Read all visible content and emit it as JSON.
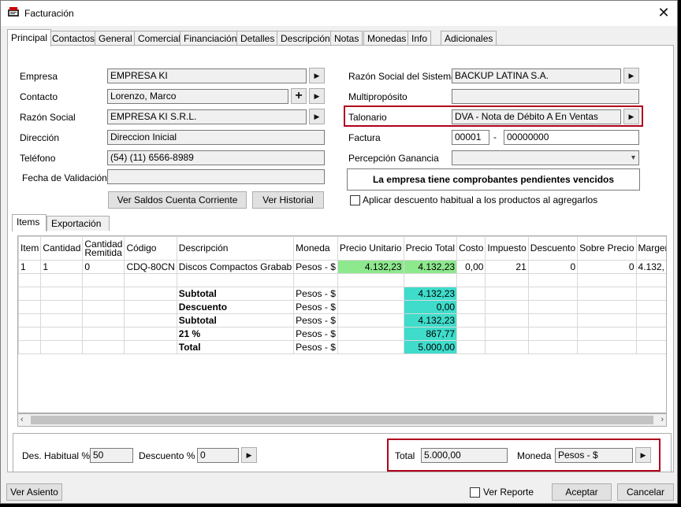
{
  "window": {
    "title": "Facturación",
    "close": "✕"
  },
  "tabs": [
    "Principal",
    "Contactos",
    "General",
    "Comercial",
    "Financiación",
    "Detalles",
    "Descripción",
    "Notas",
    "Monedas",
    "Info",
    "Adicionales"
  ],
  "left": {
    "empresa_label": "Empresa",
    "empresa_value": "EMPRESA KI",
    "contacto_label": "Contacto",
    "contacto_value": "Lorenzo, Marco",
    "razon_label": "Razón Social",
    "razon_value": "EMPRESA KI S.R.L.",
    "direccion_label": "Dirección",
    "direccion_value": "Direccion Inicial",
    "telefono_label": "Teléfono",
    "telefono_value": "(54) (11) 6566-8989",
    "fecha_label": "Fecha de Validación",
    "fecha_value": "",
    "ver_saldos": "Ver Saldos Cuenta Corriente",
    "ver_historial": "Ver Historial"
  },
  "right": {
    "razon_sistema_label": "Razón Social del Sistema",
    "razon_sistema_value": "BACKUP LATINA S.A.",
    "multiproposito_label": "Multipropósito",
    "multiproposito_value": "",
    "talonario_label": "Talonario",
    "talonario_value": "DVA - Nota de Débito A En Ventas",
    "factura_label": "Factura",
    "factura_punto": "00001",
    "factura_sep": "-",
    "factura_numero": "00000000",
    "percepcion_label": "Percepción Ganancia",
    "alert": "La empresa tiene comprobantes pendientes vencidos",
    "descuento_habitual": "Aplicar descuento habitual a los productos al agregarlos"
  },
  "subtabs": [
    "Items",
    "Exportación"
  ],
  "grid": {
    "headers": [
      "Item",
      "Cantidad",
      "Cantidad Remitida",
      "Código",
      "Descripción",
      "Moneda",
      "Precio Unitario",
      "Precio Total",
      "Costo",
      "Impuesto",
      "Descuento",
      "Sobre Precio",
      "Margen"
    ],
    "item_row": [
      "1",
      "1",
      "0",
      "CDQ-80CN",
      "Discos Compactos Grabab",
      "Pesos - $",
      "4.132,23",
      "4.132,23",
      "0,00",
      "21",
      "0",
      "0",
      "4.132,"
    ],
    "totals": [
      {
        "label": "Subtotal",
        "moneda": "Pesos - $",
        "value": "4.132,23"
      },
      {
        "label": "Descuento",
        "moneda": "Pesos - $",
        "value": "0,00"
      },
      {
        "label": "Subtotal",
        "moneda": "Pesos - $",
        "value": "4.132,23"
      },
      {
        "label": "21 %",
        "moneda": "Pesos - $",
        "value": "867,77"
      },
      {
        "label": "Total",
        "moneda": "Pesos - $",
        "value": "5.000,00"
      }
    ]
  },
  "bottom": {
    "des_habitual_label": "Des. Habitual %",
    "des_habitual_value": "50",
    "descuento_label": "Descuento %",
    "descuento_value": "0",
    "total_label": "Total",
    "total_value": "5.000,00",
    "moneda_label": "Moneda",
    "moneda_value": "Pesos - $"
  },
  "footer": {
    "ver_asiento": "Ver Asiento",
    "ver_reporte": "Ver Reporte",
    "aceptar": "Aceptar",
    "cancelar": "Cancelar"
  },
  "colors": {
    "highlight": "#b0001c",
    "green": "#8ee88e",
    "teal": "#3fdccb"
  }
}
